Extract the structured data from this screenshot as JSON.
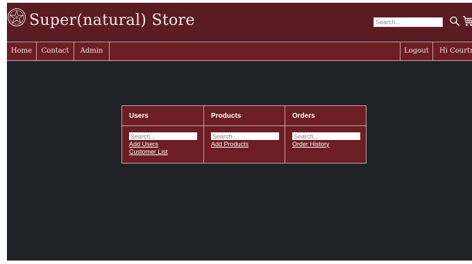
{
  "header": {
    "title": "Super(natural) Store",
    "logo_icon": "pentagram-emblem-icon",
    "search_placeholder": "Search...",
    "search_icon": "magnifier-icon",
    "cart_icon": "shopping-cart-icon"
  },
  "nav": {
    "left": [
      {
        "label": "Home"
      },
      {
        "label": "Contact"
      },
      {
        "label": "Admin"
      }
    ],
    "right": [
      {
        "label": "Logout"
      },
      {
        "label": "Hi Courtney"
      }
    ]
  },
  "admin": {
    "columns": [
      {
        "heading": "Users",
        "search_placeholder": "Search...",
        "links": [
          "Add Users",
          "Customer List"
        ]
      },
      {
        "heading": "Products",
        "search_placeholder": "Search...",
        "links": [
          "Add Products"
        ]
      },
      {
        "heading": "Orders",
        "search_placeholder": "Search...",
        "links": [
          "Order History"
        ]
      }
    ]
  },
  "colors": {
    "header_bg": "#5a1c22",
    "nav_bg": "#6d1d24",
    "page_bg": "#1f2327",
    "border": "#c9a5a8"
  }
}
